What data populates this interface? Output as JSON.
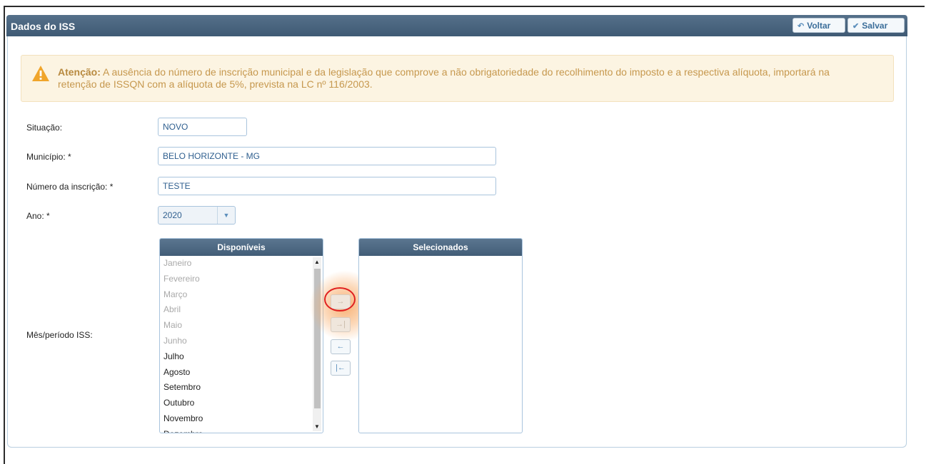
{
  "panel": {
    "title": "Dados do ISS",
    "voltar_label": "Voltar",
    "salvar_label": "Salvar"
  },
  "alert": {
    "strong": "Atenção:",
    "message": " A ausência do número de inscrição municipal e da legislação que comprove a não obrigatoriedade do recolhimento do imposto e a respectiva alíquota, importará na retenção de ISSQN com a alíquota de 5%, prevista na LC nº 116/2003."
  },
  "form": {
    "situacao_label": "Situação:",
    "situacao_value": "NOVO",
    "municipio_label": "Município: *",
    "municipio_value": "BELO HORIZONTE - MG",
    "inscricao_label": "Número da inscrição: *",
    "inscricao_value": "TESTE",
    "ano_label": "Ano: *",
    "ano_value": "2020",
    "mes_label": "Mês/período ISS:"
  },
  "dual_list": {
    "available_header": "Disponíveis",
    "selected_header": "Selecionados",
    "available": [
      {
        "label": "Janeiro",
        "enabled": false
      },
      {
        "label": "Fevereiro",
        "enabled": false
      },
      {
        "label": "Março",
        "enabled": false
      },
      {
        "label": "Abril",
        "enabled": false
      },
      {
        "label": "Maio",
        "enabled": false
      },
      {
        "label": "Junho",
        "enabled": false
      },
      {
        "label": "Julho",
        "enabled": true
      },
      {
        "label": "Agosto",
        "enabled": true
      },
      {
        "label": "Setembro",
        "enabled": true
      },
      {
        "label": "Outubro",
        "enabled": true
      },
      {
        "label": "Novembro",
        "enabled": true
      },
      {
        "label": "Dezembro",
        "enabled": true
      }
    ],
    "buttons": {
      "move_right": "→",
      "move_all_right": "→|",
      "move_left": "←",
      "move_all_left": "|←"
    }
  },
  "colors": {
    "header": "#46627c",
    "accent": "#3b6e9a",
    "alert_bg": "#fcf4e2",
    "highlight_ring": "#e02020"
  }
}
